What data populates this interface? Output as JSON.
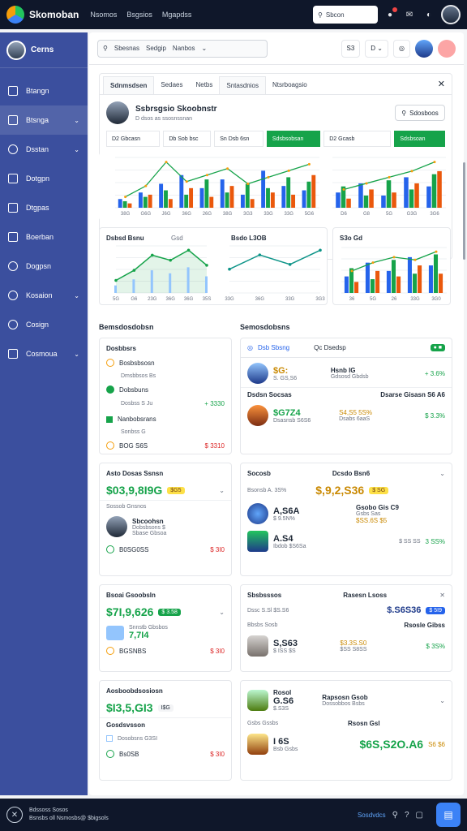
{
  "app": {
    "brand": "Skomoban",
    "nav": [
      "Nsomos",
      "Bsgsios",
      "Mgapdss"
    ]
  },
  "top": {
    "search": "Sbcon"
  },
  "sidebar": {
    "title": "Cerns",
    "items": [
      {
        "label": "Btangn",
        "chev": false
      },
      {
        "label": "Btsnga",
        "chev": true
      },
      {
        "label": "Dsstan",
        "chev": true
      },
      {
        "label": "Dotgpn",
        "chev": false
      },
      {
        "label": "Dtgpas",
        "chev": false
      },
      {
        "label": "Boerban",
        "chev": false
      },
      {
        "label": "Dogpsn",
        "chev": false
      },
      {
        "label": "Kosaion",
        "chev": true
      },
      {
        "label": "Cosign",
        "chev": false
      },
      {
        "label": "Cosmoua",
        "chev": true
      }
    ]
  },
  "main_header": {
    "search": [
      "Sbesnas",
      "Sedgip",
      "Nanbos"
    ],
    "btn1": "S3",
    "btn2": "D"
  },
  "panel": {
    "tabs": [
      "Sdnmsdsen",
      "Sedaes",
      "Netbs",
      "Sntasdnios",
      "Ntsrboagsio"
    ],
    "profile_name": "Ssbrsgsio Skoobnstr",
    "profile_sub": "D dsos as ssosnssnan",
    "profile_btn": "Sdosboos",
    "filters": [
      "D2 Gbcasn",
      "Db Sob bsc",
      "Sn Dsb 6sn",
      "Sdsbsobsan",
      "D2 Gcasb",
      "Sdsbsoan"
    ]
  },
  "charts": {
    "top_ticks": [
      "38G",
      "G6G",
      "J6G",
      "36G",
      "26G",
      "38G",
      "3G3",
      "33G",
      "33G",
      "5G6"
    ],
    "right_ticks": [
      "D6",
      "G8",
      "5G",
      "G3G",
      "3G6"
    ],
    "bottom_left_title": "Dsbsd Bsnu",
    "bottom_left_sub": "Gsd",
    "bottom_mid_title": "Bsdo L3OB",
    "bottom_right_title": "S3o Gd",
    "bl_ticks": [
      "5G",
      "G6",
      "23G",
      "36G",
      "36G",
      "35S"
    ],
    "bm_ticks": [
      "33G",
      "36G",
      "33G",
      "3G3"
    ],
    "br_ticks": [
      "36",
      "5G",
      "26",
      "33G",
      "3G0"
    ]
  },
  "sections": {
    "left": "Bemsdosdobsn",
    "right": "Semosdobsns"
  },
  "left_cards": [
    {
      "title": "Dosbbsrs",
      "r1": "Bosbsbsosn",
      "r1sub": "Dmsbbsos Bs",
      "r2": "Dobsbuns",
      "r2sub": "Dosbss S Ju",
      "r2val": "+ 3330",
      "r3": "Nanbobsrans",
      "r3sub": "Sonbss G",
      "r4": "BOG S6S",
      "r4val": "$ 3310"
    },
    {
      "title": "Asto Dosas Ssnsn",
      "big": "$03,9,8I9G",
      "badge": "$G5",
      "sub": "Sossob Gnsnos",
      "person": "Sbcoohsn",
      "personsub": "Dobsbsons $",
      "personsub2": "Sbase Gbsoa",
      "foot": "B0SG0SS",
      "footval": "$ 3I0"
    },
    {
      "title": "Bsoai Gsoobsln",
      "big": "$7I,9,626",
      "badge": "$ 3.58",
      "item": "Snnstb Gbsbos",
      "itemval": "7,7I4",
      "foot": "BGSNBS",
      "footval": "$ 3I0"
    },
    {
      "title": "Aosboobdsosiosn",
      "big": "$I3,5,GI3",
      "badge": "I$G",
      "sub": "Gosdsvsson",
      "item": "Dosobsns G3SI",
      "foot": "Bs0SB",
      "footval": "$ 3I0"
    }
  ],
  "right_list": {
    "search": "Qc Dsedsp",
    "tab": "Dsb  Sbsng",
    "rows": [
      {
        "l1": "$G:",
        "l2": "S. GS,S6",
        "r1": "Hsnb IG",
        "r2": "Gdsosd Gbdsb",
        "rv": "+ 3.6%"
      },
      {
        "name": "Dsdsn Socsas",
        "l1": "$G7Z4",
        "l2": "Dsasnsb S6S6",
        "r1": "Dsarse Gisasn S6 A6",
        "r2": "S4,S5 5S%",
        "r3": "Dsabs 6aaS",
        "rv": "$ 3.3%"
      }
    ]
  },
  "right_cards": [
    {
      "title": "Socosb",
      "sub": "Bsonsb A. 3S%",
      "rtitle": "Dcsdo Bsn6",
      "rbig": "$,9,2,S36",
      "rbadge": "$ SG",
      "mval": "A,S6A",
      "mvalsub": "$ 9.5N%",
      "r2": "Gsobo Gis C9",
      "r2sub": "Gsbs Sas",
      "r2v": "$SS.6S $5",
      "r2v2": "$ SS SS",
      "lv": "A.S4",
      "lvsub": "Ibdob $S6Sa",
      "foot": "3 SS%"
    },
    {
      "title": "Sbsbsssos",
      "sub": "Dssc S.Sl $S.S6",
      "rtitle": "Rasesn Lsoss",
      "rbig": "$.S6S36",
      "rbadge": "$ 5I9",
      "r2": "Rsosle Gibss",
      "r2v": "$3.3S.S0",
      "r2v2": "$SS S8SS",
      "mtitle": "Bbsbs Sosb",
      "mval": "S,S63",
      "mvalsub": "$ ISS $S",
      "foot": "$ 3S%"
    },
    {
      "title": "Rosol",
      "mval": "G.S6",
      "mvalsub": "$.S3S",
      "rtitle": "Rapsosn Gsob",
      "rsub": "Dossobbos Bsbs",
      "r2": "Rsosn Gsl",
      "rbig": "$6S,S2O.A6",
      "foot": "Gsbs Gssbs",
      "lv": "I 6S",
      "lvsub": "Bsb Gsbs",
      "footval": "S6 $6"
    }
  ],
  "footer": {
    "line1": "Bdssoss Sosos",
    "line2": "Bsnsbs oll Nsmosbs@ $bigsols",
    "link": "Sosdvdcs"
  },
  "chart_data": [
    {
      "type": "bar",
      "categories": [
        "38G",
        "G6G",
        "J6G",
        "36G",
        "26G",
        "38G",
        "3G3",
        "33G",
        "33G",
        "5G6"
      ],
      "series": [
        {
          "values": [
            8,
            14,
            22,
            30,
            18,
            26,
            12,
            34,
            20,
            16
          ]
        },
        {
          "values": [
            6,
            10,
            16,
            12,
            26,
            14,
            22,
            18,
            28,
            24
          ]
        },
        {
          "values": [
            4,
            12,
            8,
            18,
            10,
            20,
            8,
            14,
            12,
            30
          ]
        }
      ],
      "line": [
        10,
        20,
        42,
        24,
        30,
        36,
        22,
        28,
        34,
        40
      ]
    },
    {
      "type": "bar",
      "categories": [
        "D6",
        "G8",
        "5G",
        "G3G",
        "3G6"
      ],
      "series": [
        {
          "values": [
            10,
            16,
            8,
            20,
            14
          ]
        },
        {
          "values": [
            14,
            8,
            18,
            12,
            22
          ]
        },
        {
          "values": [
            6,
            12,
            10,
            16,
            24
          ]
        }
      ],
      "line": [
        12,
        16,
        20,
        24,
        30
      ]
    },
    {
      "type": "area",
      "categories": [
        "5G",
        "G6",
        "23G",
        "36G",
        "36G",
        "35S"
      ],
      "series": [
        {
          "values": [
            10,
            18,
            30,
            26,
            34,
            22
          ]
        }
      ]
    },
    {
      "type": "line",
      "categories": [
        "33G",
        "36G",
        "33G",
        "3G3"
      ],
      "series": [
        {
          "values": [
            20,
            32,
            24,
            36
          ]
        }
      ]
    },
    {
      "type": "bar",
      "categories": [
        "36",
        "5G",
        "26",
        "33G",
        "3G0"
      ],
      "series": [
        {
          "values": [
            12,
            22,
            16,
            26,
            20
          ]
        },
        {
          "values": [
            18,
            10,
            24,
            14,
            28
          ]
        },
        {
          "values": [
            8,
            16,
            12,
            20,
            14
          ]
        }
      ],
      "line": [
        16,
        22,
        26,
        24,
        30
      ]
    }
  ]
}
